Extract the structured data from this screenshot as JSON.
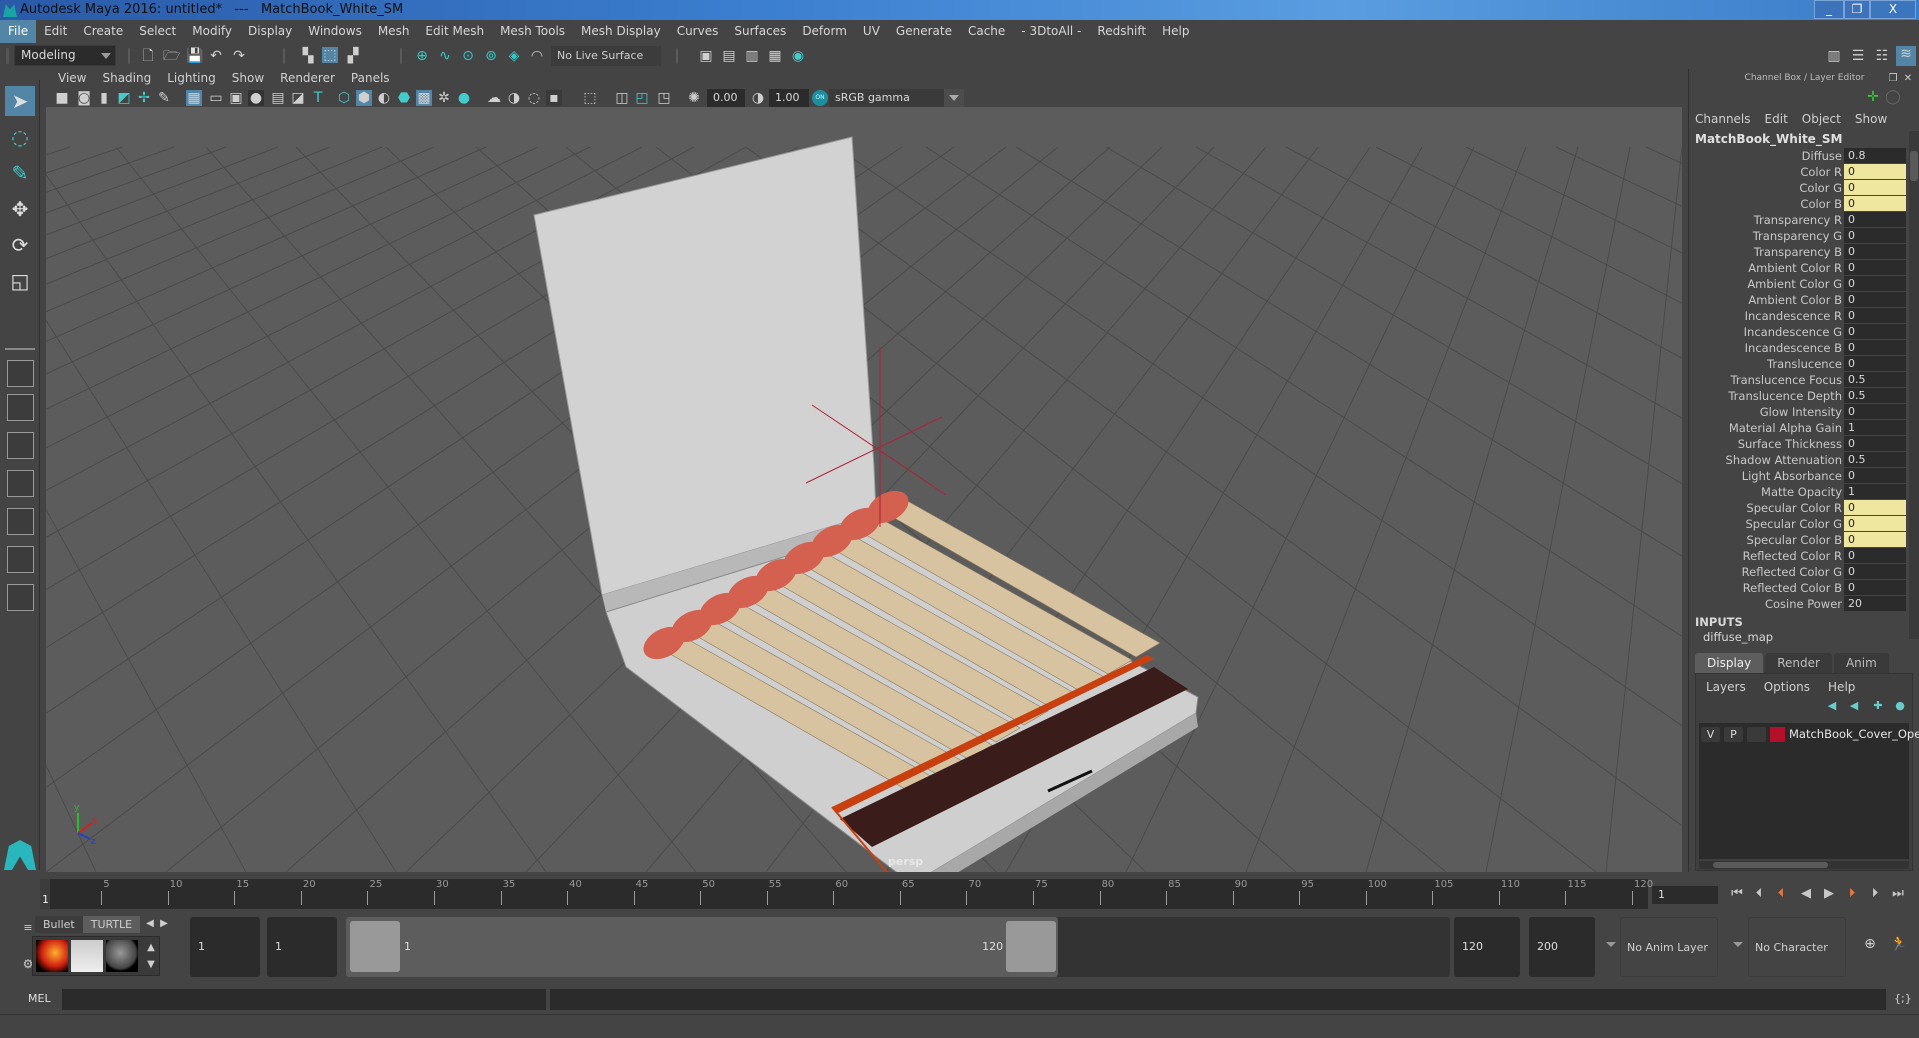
{
  "window": {
    "title": "Autodesk Maya 2016: untitled*   ---   MatchBook_White_SM",
    "minimize_label": "_",
    "restore_label": "❐",
    "close_label": "X"
  },
  "menubar": {
    "items": [
      "File",
      "Edit",
      "Create",
      "Select",
      "Modify",
      "Display",
      "Windows",
      "Mesh",
      "Edit Mesh",
      "Mesh Tools",
      "Mesh Display",
      "Curves",
      "Surfaces",
      "Deform",
      "UV",
      "Generate",
      "Cache",
      "- 3DtoAll -",
      "Redshift",
      "Help"
    ],
    "active_index": 0
  },
  "statusline": {
    "menuset": "Modeling",
    "live_surface": "No Live Surface"
  },
  "viewport": {
    "menu": [
      "View",
      "Shading",
      "Lighting",
      "Show",
      "Renderer",
      "Panels"
    ],
    "exposure": "0.00",
    "gamma": "1.00",
    "color_space_toggle": "ON",
    "color_space": "sRGB gamma",
    "camera_label": "persp",
    "axis_labels": {
      "x": "x",
      "y": "y",
      "z": "z"
    },
    "model_colors": {
      "cover": "#d8d8d8",
      "match_stick": "#d8c3a0",
      "match_head": "#d4604f",
      "striker": "#3a1d1a",
      "trim": "#c84010",
      "grid_bg": "#5c5c5c",
      "grid_line": "#4a4a4a",
      "manipulator": "#b0203a"
    }
  },
  "channel_box": {
    "header": "Channel Box / Layer Editor",
    "menu": [
      "Channels",
      "Edit",
      "Object",
      "Show"
    ],
    "object_name": "MatchBook_White_SM",
    "attributes": [
      {
        "label": "Diffuse",
        "value": "0.8",
        "keyed": false
      },
      {
        "label": "Color R",
        "value": "0",
        "keyed": true
      },
      {
        "label": "Color G",
        "value": "0",
        "keyed": true
      },
      {
        "label": "Color B",
        "value": "0",
        "keyed": true
      },
      {
        "label": "Transparency R",
        "value": "0",
        "keyed": false
      },
      {
        "label": "Transparency G",
        "value": "0",
        "keyed": false
      },
      {
        "label": "Transparency B",
        "value": "0",
        "keyed": false
      },
      {
        "label": "Ambient Color R",
        "value": "0",
        "keyed": false
      },
      {
        "label": "Ambient Color G",
        "value": "0",
        "keyed": false
      },
      {
        "label": "Ambient Color B",
        "value": "0",
        "keyed": false
      },
      {
        "label": "Incandescence R",
        "value": "0",
        "keyed": false
      },
      {
        "label": "Incandescence G",
        "value": "0",
        "keyed": false
      },
      {
        "label": "Incandescence B",
        "value": "0",
        "keyed": false
      },
      {
        "label": "Translucence",
        "value": "0",
        "keyed": false
      },
      {
        "label": "Translucence Focus",
        "value": "0.5",
        "keyed": false
      },
      {
        "label": "Translucence Depth",
        "value": "0.5",
        "keyed": false
      },
      {
        "label": "Glow Intensity",
        "value": "0",
        "keyed": false
      },
      {
        "label": "Material Alpha Gain",
        "value": "1",
        "keyed": false
      },
      {
        "label": "Surface Thickness",
        "value": "0",
        "keyed": false
      },
      {
        "label": "Shadow Attenuation",
        "value": "0.5",
        "keyed": false
      },
      {
        "label": "Light Absorbance",
        "value": "0",
        "keyed": false
      },
      {
        "label": "Matte Opacity",
        "value": "1",
        "keyed": false
      },
      {
        "label": "Specular Color R",
        "value": "0",
        "keyed": true
      },
      {
        "label": "Specular Color G",
        "value": "0",
        "keyed": true
      },
      {
        "label": "Specular Color B",
        "value": "0",
        "keyed": true
      },
      {
        "label": "Reflected Color R",
        "value": "0",
        "keyed": false
      },
      {
        "label": "Reflected Color G",
        "value": "0",
        "keyed": false
      },
      {
        "label": "Reflected Color B",
        "value": "0",
        "keyed": false
      },
      {
        "label": "Cosine Power",
        "value": "20",
        "keyed": false
      }
    ],
    "inputs_label": "INPUTS",
    "input_node": "diffuse_map"
  },
  "layer_editor": {
    "tabs": [
      "Display",
      "Render",
      "Anim"
    ],
    "active_tab": 0,
    "menu": [
      "Layers",
      "Options",
      "Help"
    ],
    "layers": [
      {
        "visible": "V",
        "playback": "P",
        "color": "#b5102a",
        "name": "MatchBook_Cover_Oper"
      }
    ]
  },
  "timeline": {
    "current_frame": "1",
    "ticks": [
      "5",
      "10",
      "15",
      "20",
      "25",
      "30",
      "35",
      "40",
      "45",
      "50",
      "55",
      "60",
      "65",
      "70",
      "75",
      "80",
      "85",
      "90",
      "95",
      "100",
      "105",
      "110",
      "115",
      "120"
    ],
    "start": 1,
    "end": 120,
    "frame_field": "1"
  },
  "range": {
    "shelf_tabs": [
      "Bullet",
      "TURTLE"
    ],
    "active_shelf": 1,
    "start_time": "1",
    "playback_start": "1",
    "range_start_label": "1",
    "range_end_label": "120",
    "playback_end": "120",
    "end_time": "200",
    "anim_layer": "No Anim Layer",
    "character_set": "No Character Set"
  },
  "mel": {
    "label": "MEL"
  }
}
